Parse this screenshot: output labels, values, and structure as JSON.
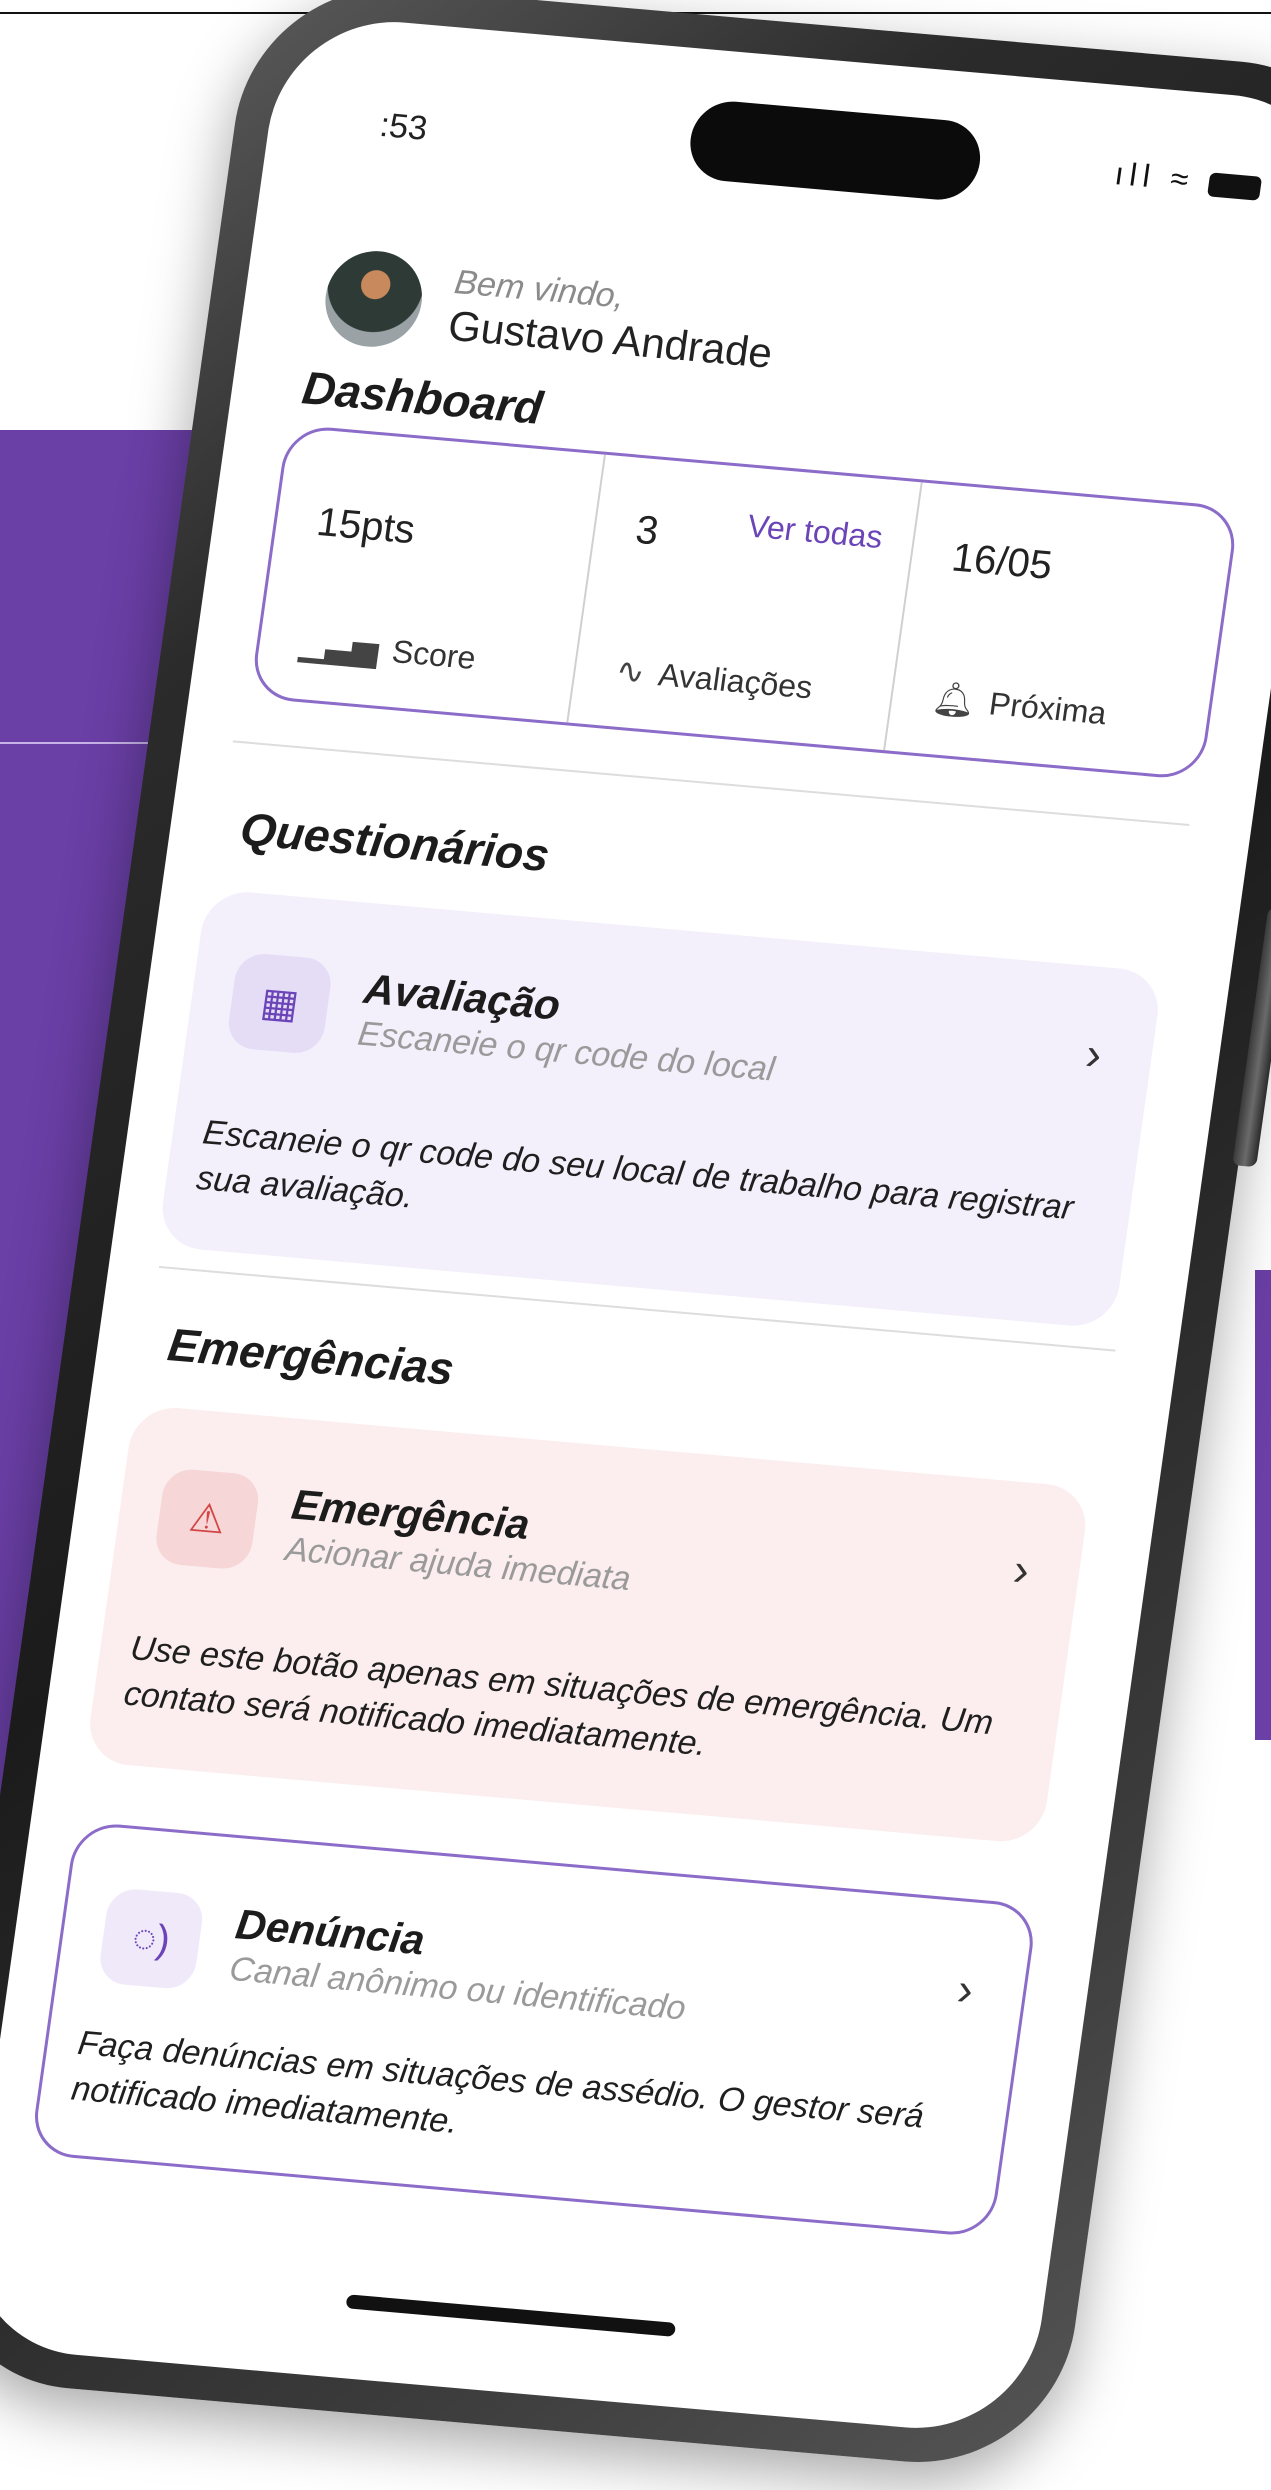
{
  "status": {
    "time": ":53",
    "signal": "ıll",
    "wifi": "≈"
  },
  "greeting": {
    "welcome": "Bem vindo,",
    "name": "Gustavo Andrade"
  },
  "dashboard": {
    "title": "Dashboard",
    "score": {
      "value": "15pts",
      "label": "Score",
      "icon": "chart-icon"
    },
    "evaluations": {
      "value": "3",
      "link": "Ver todas",
      "label": "Avaliações",
      "icon": "pulse-icon"
    },
    "next": {
      "value": "16/05",
      "label": "Próxima",
      "icon": "bell-icon"
    }
  },
  "questionnaires": {
    "title": "Questionários",
    "card": {
      "title": "Avaliação",
      "subtitle": "Escaneie o qr code do local",
      "description": "Escaneie o qr code do seu local de trabalho para registrar sua avaliação.",
      "icon": "qr-code-icon"
    }
  },
  "emergencies": {
    "title": "Emergências",
    "emergency_card": {
      "title": "Emergência",
      "subtitle": "Acionar ajuda imediata",
      "description": "Use este botão apenas em situações de emergência. Um contato será notificado imediatamente.",
      "icon": "siren-icon"
    },
    "report_card": {
      "title": "Denúncia",
      "subtitle": "Canal anônimo ou identificado",
      "description": "Faça denúncias em situações de assédio. O gestor será notificado imediatamente.",
      "icon": "speech-icon"
    }
  },
  "colors": {
    "accent": "#6b45b8",
    "background_purple": "#6a3fa6",
    "emergency_bg": "#fceeee",
    "quest_bg": "#f3effb"
  }
}
